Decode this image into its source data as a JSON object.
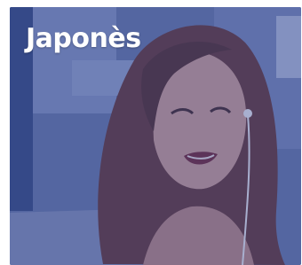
{
  "card": {
    "title": "Japonès",
    "image_icon": "woman-smiling-with-earphones-photo",
    "overlay_color": "#2d3e8c"
  }
}
